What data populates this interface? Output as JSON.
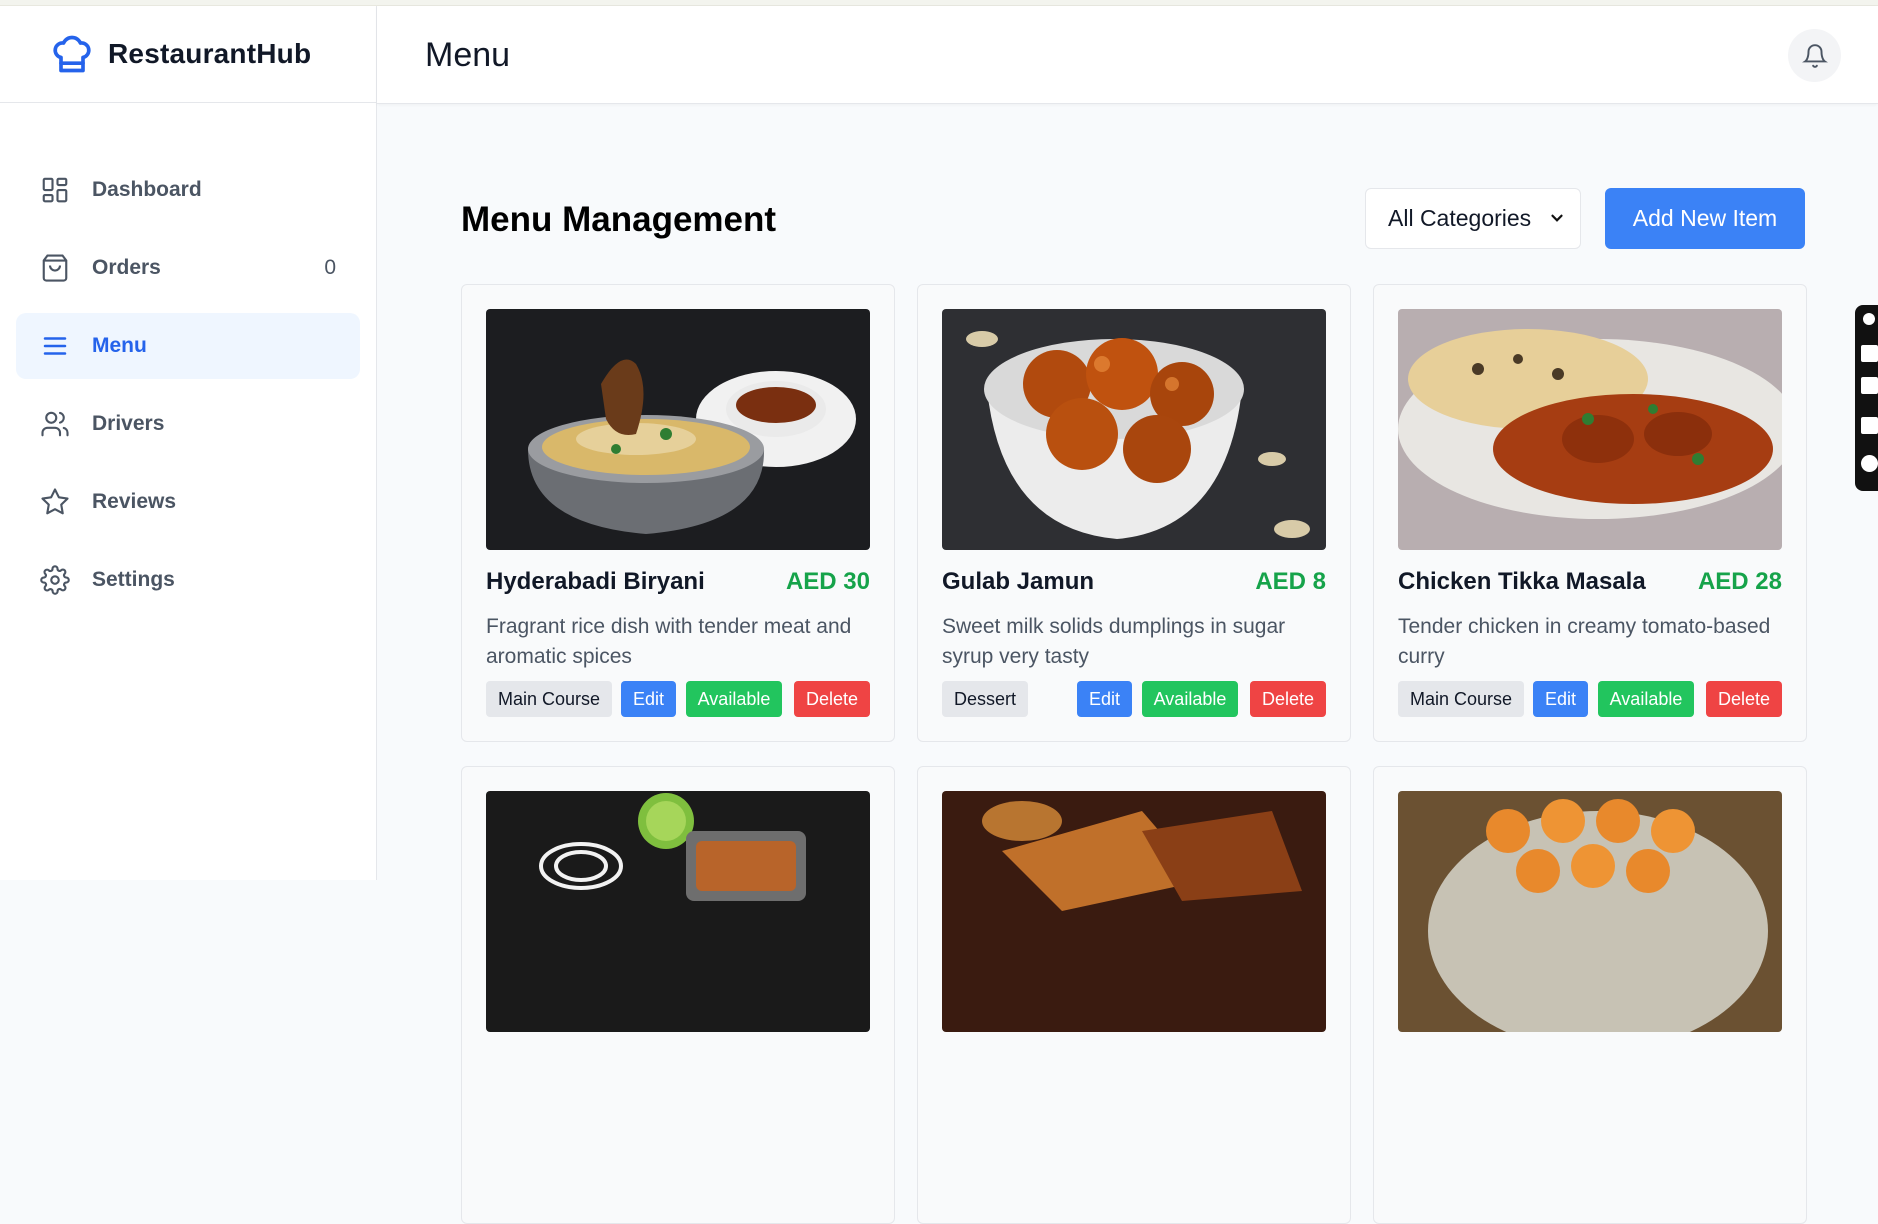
{
  "app": {
    "brand": "RestaurantHub",
    "logo_icon": "chef-hat-icon",
    "accent": "#2563eb"
  },
  "sidebar": {
    "items": [
      {
        "label": "Dashboard",
        "icon": "grid-icon",
        "count": ""
      },
      {
        "label": "Orders",
        "icon": "shopping-bag-icon",
        "count": "0"
      },
      {
        "label": "Menu",
        "icon": "menu-lines-icon",
        "count": "",
        "active": true
      },
      {
        "label": "Drivers",
        "icon": "users-icon",
        "count": ""
      },
      {
        "label": "Reviews",
        "icon": "star-icon",
        "count": ""
      },
      {
        "label": "Settings",
        "icon": "gear-icon",
        "count": ""
      }
    ]
  },
  "header": {
    "title": "Menu",
    "bell_icon": "bell-icon"
  },
  "main": {
    "title": "Menu Management",
    "category_select": {
      "selected": "All Categories"
    },
    "add_button": "Add New Item",
    "cards": [
      {
        "name": "Hyderabadi Biryani",
        "price": "AED 30",
        "description": "Fragrant rice dish with tender meat and aromatic spices",
        "category": "Main Course",
        "edit": "Edit",
        "status": "Available",
        "delete": "Delete"
      },
      {
        "name": "Gulab Jamun",
        "price": "AED 8",
        "description": "Sweet milk solids dumplings in sugar syrup very tasty",
        "category": "Dessert",
        "edit": "Edit",
        "status": "Available",
        "delete": "Delete"
      },
      {
        "name": "Chicken Tikka Masala",
        "price": "AED 28",
        "description": "Tender chicken in creamy tomato-based curry",
        "category": "Main Course",
        "edit": "Edit",
        "status": "Available",
        "delete": "Delete"
      }
    ]
  },
  "colors": {
    "price": "#16a34a",
    "edit": "#3b82f6",
    "available": "#22c55e",
    "delete": "#ef4444"
  }
}
